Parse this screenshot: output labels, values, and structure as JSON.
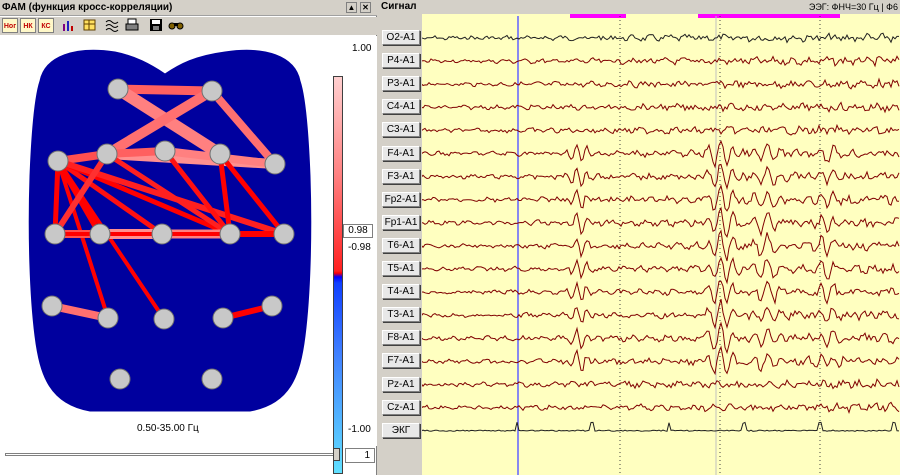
{
  "left_panel": {
    "title": "ФАМ (функция кросс-корреляции)",
    "toolbar": [
      {
        "label": "Ног",
        "name": "mode-nog-button"
      },
      {
        "label": "НК",
        "name": "mode-nk-button"
      },
      {
        "label": "КС",
        "name": "mode-ks-button"
      },
      {
        "label": "",
        "name": "chart-icon"
      },
      {
        "label": "",
        "name": "table-icon"
      },
      {
        "label": "",
        "name": "wave-icon"
      },
      {
        "label": "",
        "name": "print-icon"
      },
      {
        "label": "",
        "name": "save-icon"
      },
      {
        "label": "",
        "name": "binoculars-icon"
      }
    ],
    "frequency_range": "0.50-35.00  Гц",
    "colorbar": {
      "max_label": "1.00",
      "threshold_value": "0.98",
      "neg_threshold": "-0.98",
      "min_label": "-1.00",
      "colors": {
        "high": "#ffd0d0",
        "mid": "#ff0000",
        "low_neg": "#0000ff",
        "min": "#60e0ff"
      }
    },
    "page_number": "1",
    "slider_position": 1.0,
    "head_color": "#00009e",
    "electrode_color": "#c8c8c8"
  },
  "right_panel": {
    "title": "Сигнал",
    "info": "ЭЭГ: ФНЧ=30 Гц  | Ф6",
    "background": "#ffffc0",
    "trace_color": "#800000",
    "channels": [
      "O2-A1",
      "P4-A1",
      "P3-A1",
      "C4-A1",
      "C3-A1",
      "F4-A1",
      "F3-A1",
      "Fp2-A1",
      "Fp1-A1",
      "T6-A1",
      "T5-A1",
      "T4-A1",
      "T3-A1",
      "F8-A1",
      "F7-A1",
      "Pz-A1",
      "Cz-A1",
      "ЭКГ"
    ]
  }
}
